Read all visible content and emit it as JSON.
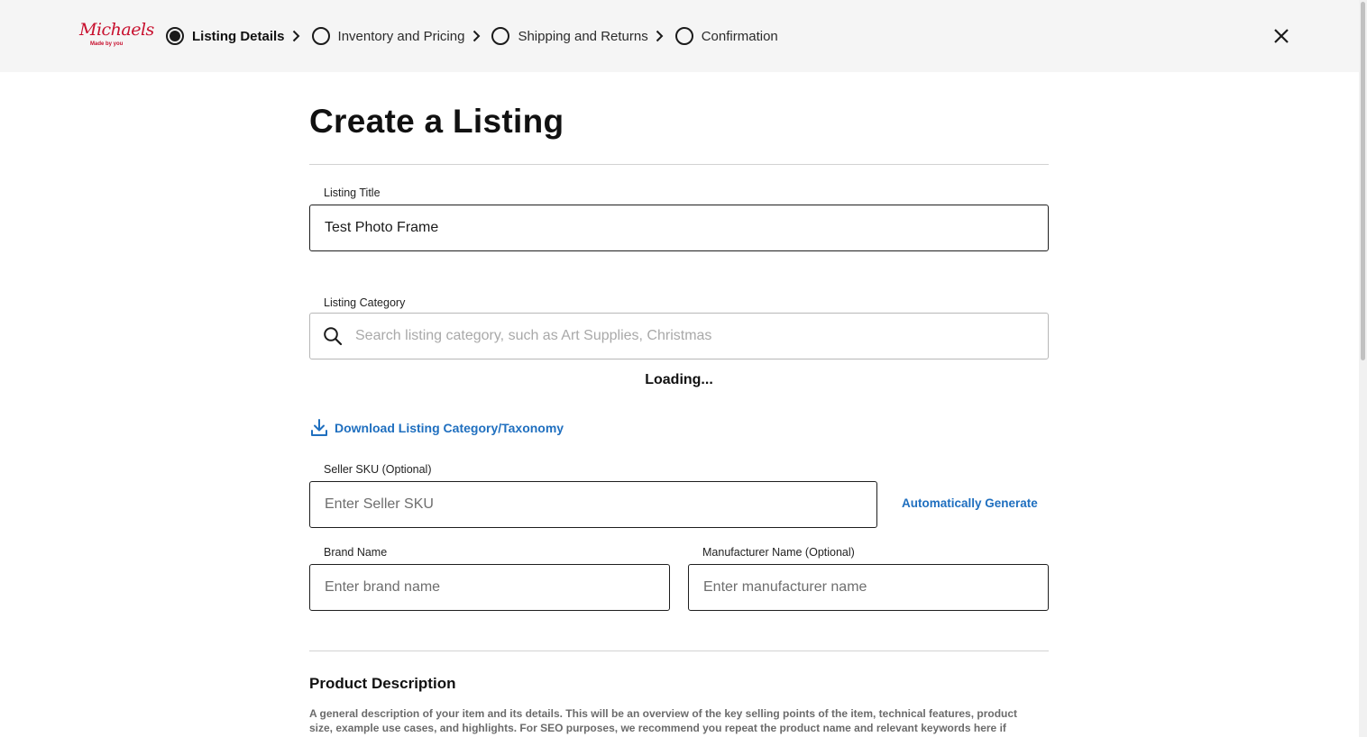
{
  "header": {
    "logo": {
      "script": "Michaels",
      "tagline": "Made by you"
    },
    "steps": [
      {
        "label": "Listing Details",
        "active": true
      },
      {
        "label": "Inventory and Pricing",
        "active": false
      },
      {
        "label": "Shipping and Returns",
        "active": false
      },
      {
        "label": "Confirmation",
        "active": false
      }
    ]
  },
  "main": {
    "title": "Create a Listing",
    "listing_title": {
      "label": "Listing Title",
      "value": "Test Photo Frame"
    },
    "listing_category": {
      "label": "Listing Category",
      "placeholder": "Search listing category, such as Art Supplies, Christmas",
      "status": "Loading..."
    },
    "download_link": "Download Listing Category/Taxonomy",
    "seller_sku": {
      "label": "Seller SKU (Optional)",
      "placeholder": "Enter Seller SKU",
      "auto_generate": "Automatically Generate"
    },
    "brand_name": {
      "label": "Brand Name",
      "placeholder": "Enter brand name"
    },
    "manufacturer_name": {
      "label": "Manufacturer Name (Optional)",
      "placeholder": "Enter manufacturer name"
    },
    "product_description": {
      "heading": "Product Description",
      "text": "A general description of your item and its details. This will be an overview of the key selling points of the item, technical features, product size, example use cases, and highlights. For SEO purposes, we recommend you repeat the product name and relevant keywords here if"
    }
  },
  "colors": {
    "brand_red": "#c8102e",
    "link_blue": "#1f6fbf",
    "header_bg": "#f5f5f5"
  },
  "icons": [
    "step-active-icon",
    "step-inactive-icon",
    "chevron-right-icon",
    "close-icon",
    "search-icon",
    "download-icon"
  ]
}
